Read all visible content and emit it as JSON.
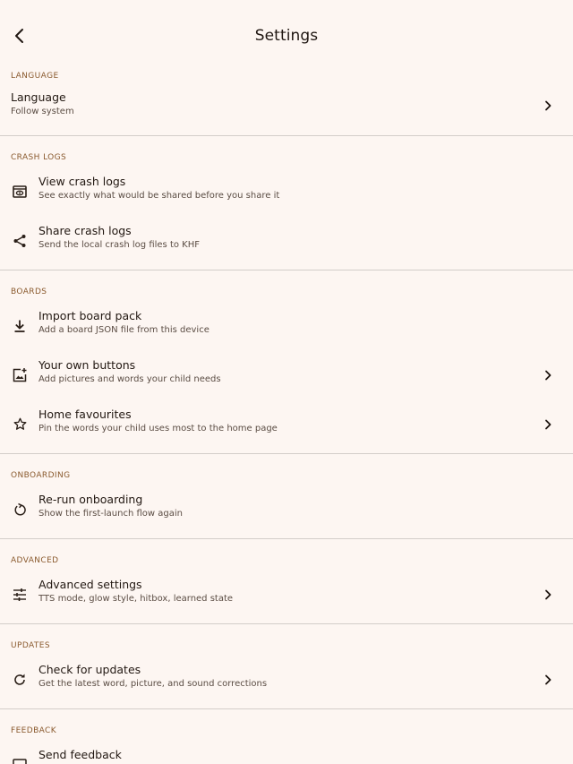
{
  "header": {
    "title": "Settings",
    "back_icon": "arrow-back-icon"
  },
  "sections": {
    "language": {
      "label": "LANGUAGE",
      "items": [
        {
          "title": "Language",
          "subtitle": "Follow system",
          "icon": "none",
          "chevron": true
        }
      ]
    },
    "crash_logs": {
      "label": "CRASH LOGS",
      "items": [
        {
          "title": "View crash logs",
          "subtitle": "See exactly what would be shared before you share it",
          "icon": "preview-icon",
          "chevron": false
        },
        {
          "title": "Share crash logs",
          "subtitle": "Send the local crash log files to KHF",
          "icon": "share-icon",
          "chevron": false
        }
      ]
    },
    "boards": {
      "label": "BOARDS",
      "items": [
        {
          "title": "Import board pack",
          "subtitle": "Add a board JSON file from this device",
          "icon": "download-icon",
          "chevron": false
        },
        {
          "title": "Your own buttons",
          "subtitle": "Add pictures and words your child needs",
          "icon": "add-photo-icon",
          "chevron": true
        },
        {
          "title": "Home favourites",
          "subtitle": "Pin the words your child uses most to the home page",
          "icon": "star-icon",
          "chevron": true
        }
      ]
    },
    "onboarding": {
      "label": "ONBOARDING",
      "items": [
        {
          "title": "Re-run onboarding",
          "subtitle": "Show the first-launch flow again",
          "icon": "restart-icon",
          "chevron": false
        }
      ]
    },
    "advanced": {
      "label": "ADVANCED",
      "items": [
        {
          "title": "Advanced settings",
          "subtitle": "TTS mode, glow style, hitbox, learned state",
          "icon": "tune-icon",
          "chevron": true
        }
      ]
    },
    "updates": {
      "label": "UPDATES",
      "items": [
        {
          "title": "Check for updates",
          "subtitle": "Get the latest word, picture, and sound corrections",
          "icon": "refresh-icon",
          "chevron": true
        }
      ]
    },
    "feedback": {
      "label": "FEEDBACK",
      "items": [
        {
          "title": "Send feedback",
          "subtitle": "",
          "icon": "feedback-icon",
          "chevron": false
        }
      ]
    }
  },
  "colors": {
    "background": "#fdf6f2",
    "section_label": "#8a5a2e",
    "divider": "#d3cdc9",
    "text_primary": "#221812",
    "text_secondary": "#5b4d44"
  }
}
